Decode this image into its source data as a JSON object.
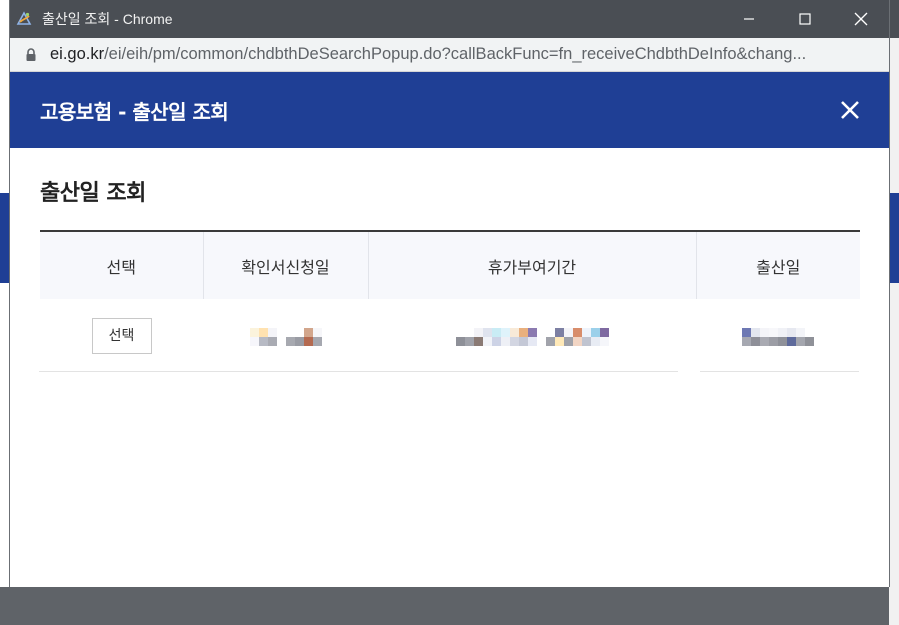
{
  "window": {
    "title": "출산일 조회 - Chrome",
    "url_host": "ei.go.kr",
    "url_path": "/ei/eih/pm/common/chdbthDeSearchPopup.do?callBackFunc=fn_receiveChdbthDeInfo&chang..."
  },
  "popup": {
    "header_title": "고용보험 - 출산일 조회",
    "section_title": "출산일 조회"
  },
  "table": {
    "columns": [
      "선택",
      "확인서신청일",
      "휴가부여기간",
      "출산일"
    ],
    "rows": [
      {
        "select_label": "선택"
      }
    ]
  },
  "colors": {
    "header_blue": "#1f3f95",
    "titlebar": "#4a4e54",
    "table_head_bg": "#f7f8fc"
  },
  "icons": {
    "app": "chrome-app-icon",
    "lock": "lock-icon",
    "close": "close-icon"
  }
}
